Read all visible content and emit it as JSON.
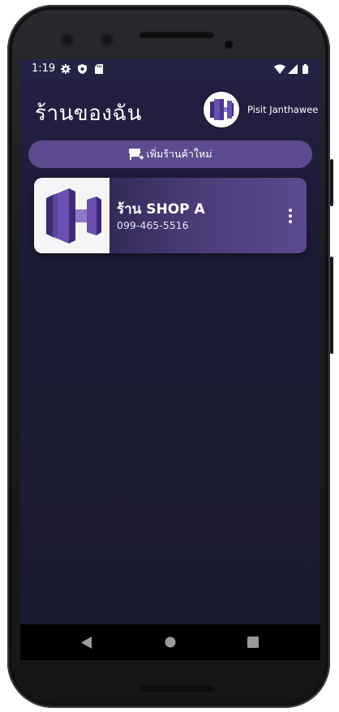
{
  "status_bar": {
    "time": "1:19",
    "left_icons": [
      "gear-icon",
      "shield-icon",
      "sd-card-icon"
    ],
    "right_icons": [
      "wifi-icon",
      "signal-icon",
      "battery-icon"
    ]
  },
  "header": {
    "title": "ร้านของฉัน",
    "user_name": "Pisit Janthawee"
  },
  "add_store_button": {
    "icon": "store-add-icon",
    "label": "เพิ่มร้านค้าใหม่"
  },
  "shops": [
    {
      "name": "ร้าน SHOP A",
      "phone": "099-465-5516"
    }
  ],
  "nav_bar": [
    "back-icon",
    "home-icon",
    "recents-icon"
  ],
  "colors": {
    "background": "#1b1b2f",
    "status_bar": "#232344",
    "accent": "#5e4a8f",
    "card_gradient_end": "#5c4a8e",
    "logo_purple": "#6a4fb0"
  }
}
